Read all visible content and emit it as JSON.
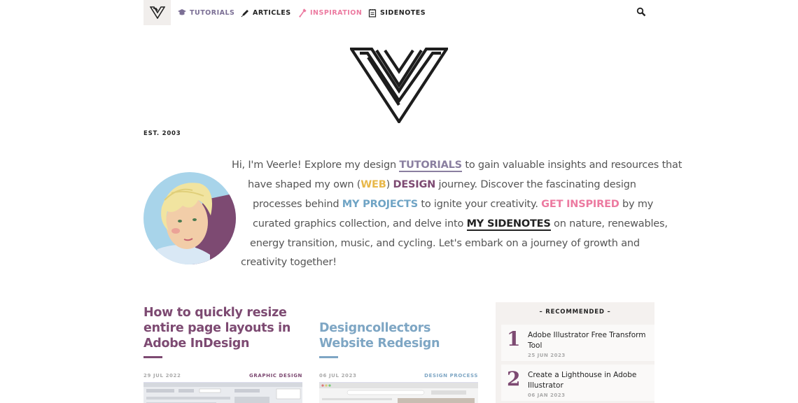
{
  "nav": {
    "items": [
      {
        "label": "TUTORIALS",
        "icon": "graduation-cap-icon",
        "color": "#7b6f95"
      },
      {
        "label": "ARTICLES",
        "icon": "pen-icon",
        "color": "#222222"
      },
      {
        "label": "INSPIRATION",
        "icon": "dropper-icon",
        "color": "#ec7aa0"
      },
      {
        "label": "SIDENOTES",
        "icon": "notepad-icon",
        "color": "#222222"
      }
    ],
    "search_icon": "search-icon"
  },
  "hero": {
    "est": "EST. 2003"
  },
  "intro": {
    "l1_a": "Hi, I'm Veerle! Explore my design ",
    "l1_link": "TUTORIALS",
    "l1_b": " to gain valuable insights and resources that",
    "l2_a": "have shaped my own (",
    "l2_web": "WEB",
    "l2_b": ") ",
    "l2_design": "DESIGN",
    "l2_c": " journey. Discover the fascinating design",
    "l3_a": "processes behind ",
    "l3_proj": "MY PROJECTS",
    "l3_b": " to ignite your creativity. ",
    "l3_insp": "GET INSPIRED",
    "l3_c": " by my",
    "l4_a": "curated graphics collection, and delve into ",
    "l4_side": "MY SIDENOTES",
    "l4_b": " on nature, renewables,",
    "l5": "energy transition, music, and cycling. Let's embark on a journey of growth and",
    "l6": "creativity together!"
  },
  "articles": [
    {
      "title": "How to quickly resize entire page layouts in Adobe InDesign",
      "date": "29 JUL 2022",
      "category": "GRAPHIC DESIGN",
      "color": "#7d4a72"
    },
    {
      "title": "Designcollectors Website Redesign",
      "date": "06 JUL 2023",
      "category": "DESIGN PROCESS",
      "color": "#7ea6c4"
    }
  ],
  "recommended": {
    "heading": "– RECOMMENDED –",
    "items": [
      {
        "num": "1",
        "title": "Adobe Illustrator Free Transform Tool",
        "date": "25 JUN 2023"
      },
      {
        "num": "2",
        "title": "Create a Lighthouse in Adobe Illustrator",
        "date": "06 JAN 2023"
      }
    ]
  }
}
